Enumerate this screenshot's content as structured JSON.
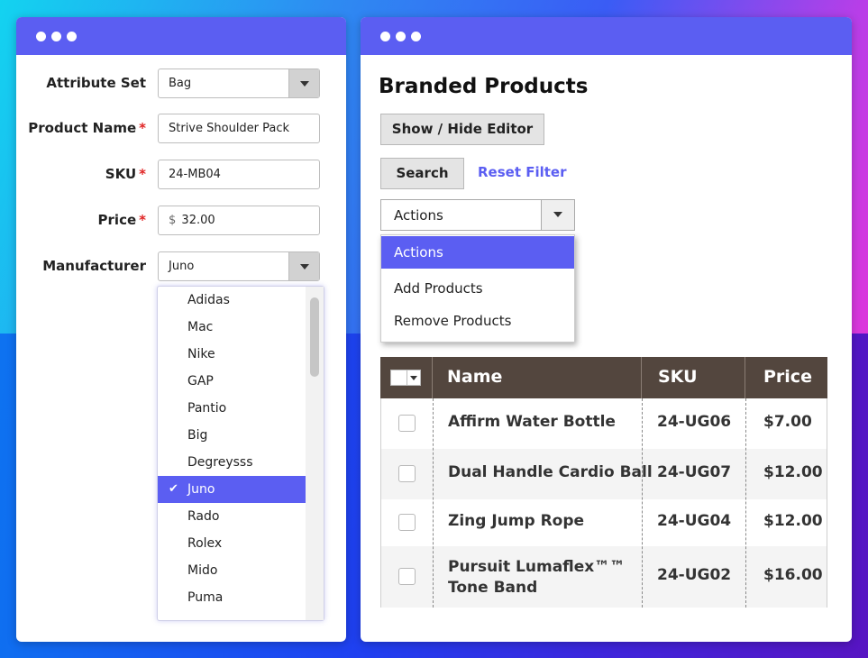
{
  "left_form": {
    "attribute_set": {
      "label": "Attribute Set",
      "value": "Bag"
    },
    "product_name": {
      "label": "Product Name",
      "required_mark": "*",
      "value": "Strive Shoulder Pack"
    },
    "sku": {
      "label": "SKU",
      "required_mark": "*",
      "value": "24-MB04"
    },
    "price": {
      "label": "Price",
      "required_mark": "*",
      "currency": "$",
      "value": "32.00"
    },
    "manufacturer": {
      "label": "Manufacturer",
      "value": "Juno",
      "options": [
        "Adidas",
        "Mac",
        "Nike",
        "GAP",
        "Pantio",
        "Big",
        "Degreysss",
        "Juno",
        "Rado",
        "Rolex",
        "Mido",
        "Puma"
      ],
      "selected_index": 7,
      "check_glyph": "✔"
    }
  },
  "right_panel": {
    "title": "Branded Products",
    "show_hide_label": "Show / Hide Editor",
    "search_label": "Search",
    "reset_filter_label": "Reset Filter",
    "actions": {
      "value": "Actions",
      "menu": [
        "Actions",
        "Add Products",
        "Remove Products"
      ]
    },
    "grid": {
      "columns": [
        "Name",
        "SKU",
        "Price"
      ],
      "rows": [
        {
          "name": "Affirm Water Bottle",
          "name2": "",
          "sku": "24-UG06",
          "price": "$7.00"
        },
        {
          "name": "Dual Handle Cardio Ball",
          "name2": "",
          "sku": "24-UG07",
          "price": "$12.00"
        },
        {
          "name": "Zing Jump Rope",
          "name2": "",
          "sku": "24-UG04",
          "price": "$12.00"
        },
        {
          "name": "Pursuit Lumaflex™™",
          "name2": "Tone Band",
          "sku": "24-UG02",
          "price": "$16.00"
        }
      ]
    }
  },
  "colors": {
    "accent": "#5b5ef2",
    "required": "#e02424",
    "grid_header": "#53463e"
  },
  "icons": {
    "window_controls": "three-dots",
    "select_arrow": "chevron-down-icon",
    "selected_mark": "check-icon"
  }
}
